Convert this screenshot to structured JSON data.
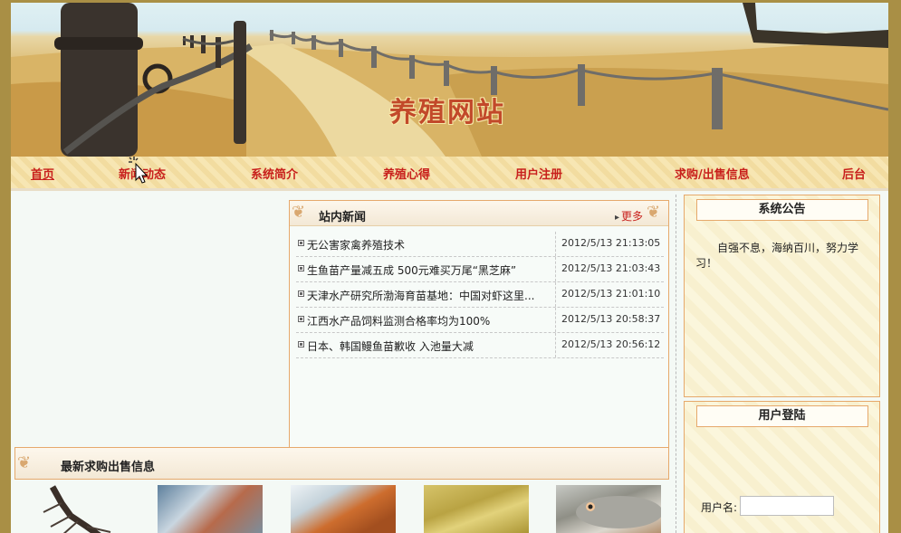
{
  "banner": {
    "site_title": "养殖网站"
  },
  "nav": {
    "items": [
      {
        "label": "首页"
      },
      {
        "label": "新闻动态"
      },
      {
        "label": "系统简介"
      },
      {
        "label": "养殖心得"
      },
      {
        "label": "用户注册"
      },
      {
        "label": "求购/出售信息"
      },
      {
        "label": "后台"
      }
    ]
  },
  "news": {
    "title": "站内新闻",
    "more_label": "更多",
    "items": [
      {
        "title": "无公害家禽养殖技术",
        "date": "2012/5/13 21:13:05"
      },
      {
        "title": "生鱼苗产量减五成 500元难买万尾“黑芝麻”",
        "date": "2012/5/13 21:03:43"
      },
      {
        "title": "天津水产研究所渤海育苗基地：中国对虾这里...",
        "date": "2012/5/13 21:01:10"
      },
      {
        "title": "江西水产品饲料监测合格率均为100%",
        "date": "2012/5/13 20:58:37"
      },
      {
        "title": "日本、韩国鳗鱼苗歉收 入池量大减",
        "date": "2012/5/13 20:56:12"
      }
    ]
  },
  "trade": {
    "title": "最新求购出售信息"
  },
  "notice": {
    "title": "系统公告",
    "text": "自强不息，海纳百川，努力学习！"
  },
  "login": {
    "title": "用户登陆",
    "username_label": "用户名:",
    "username_value": ""
  },
  "colors": {
    "nav_text": "#c8201c",
    "border_accent": "#e6a96c",
    "page_frame": "#a98f45"
  }
}
